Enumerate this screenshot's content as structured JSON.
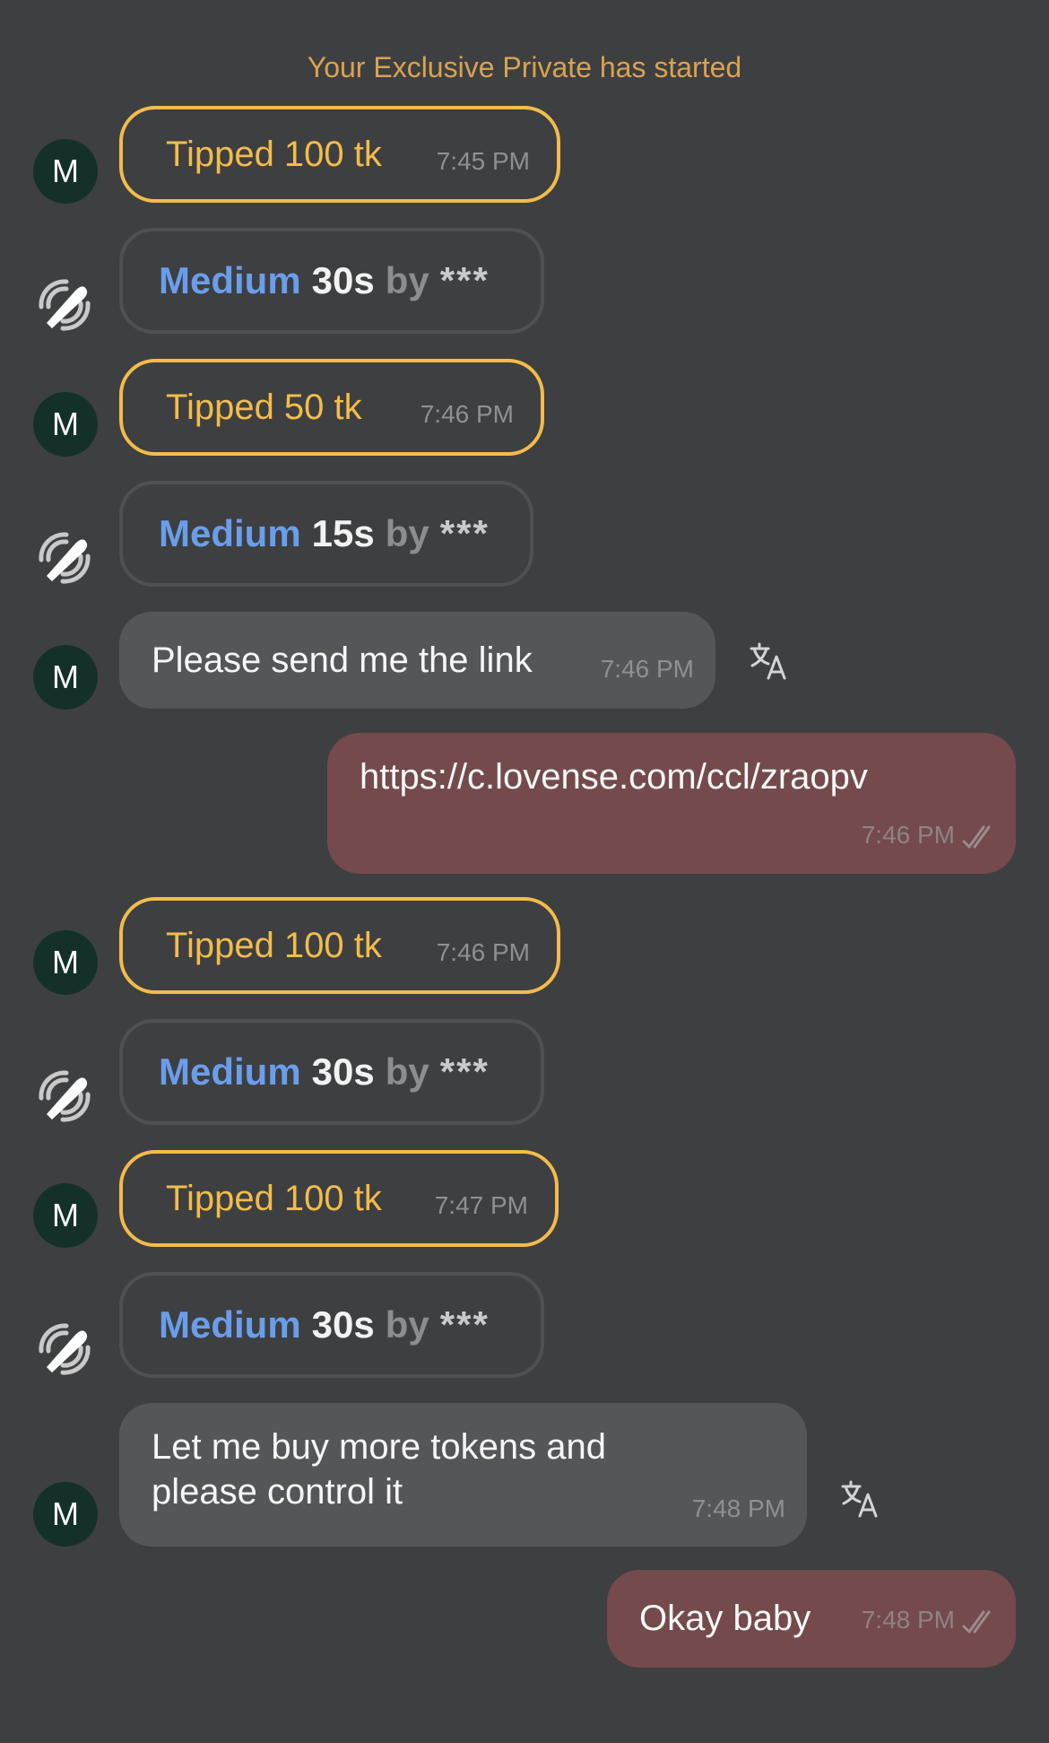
{
  "system_message": "Your Exclusive Private has started",
  "avatar_letter": "M",
  "tips": [
    {
      "text": "Tipped 100 tk",
      "time": "7:45 PM"
    },
    {
      "text": "Tipped 50 tk",
      "time": "7:46 PM"
    },
    {
      "text": "Tipped 100 tk",
      "time": "7:46 PM"
    },
    {
      "text": "Tipped 100 tk",
      "time": "7:47 PM"
    }
  ],
  "toys": [
    {
      "level": "Medium",
      "duration": "30s",
      "by": "by",
      "user": "***"
    },
    {
      "level": "Medium",
      "duration": "15s",
      "by": "by",
      "user": "***"
    },
    {
      "level": "Medium",
      "duration": "30s",
      "by": "by",
      "user": "***"
    },
    {
      "level": "Medium",
      "duration": "30s",
      "by": "by",
      "user": "***"
    }
  ],
  "incoming": [
    {
      "line1": "Please send me the link",
      "line2": "",
      "time": "7:46 PM"
    },
    {
      "line1": "Let me buy more tokens and",
      "line2": "please control it",
      "time": "7:48 PM"
    }
  ],
  "outgoing": [
    {
      "text": "https://c.lovense.com/ccl/zraopv",
      "time": "7:46 PM"
    },
    {
      "text": "Okay baby",
      "time": "7:48 PM"
    }
  ],
  "colors": {
    "background": "#3e3f41",
    "tip_accent": "#f2bc4b",
    "level_blue": "#6a9eeb",
    "outgoing_bubble": "#744a4c",
    "incoming_bubble": "#55565a",
    "avatar_bg": "#14302b"
  },
  "icons": [
    "toy-vibration-icon",
    "translate-icon",
    "double-check-icon"
  ]
}
